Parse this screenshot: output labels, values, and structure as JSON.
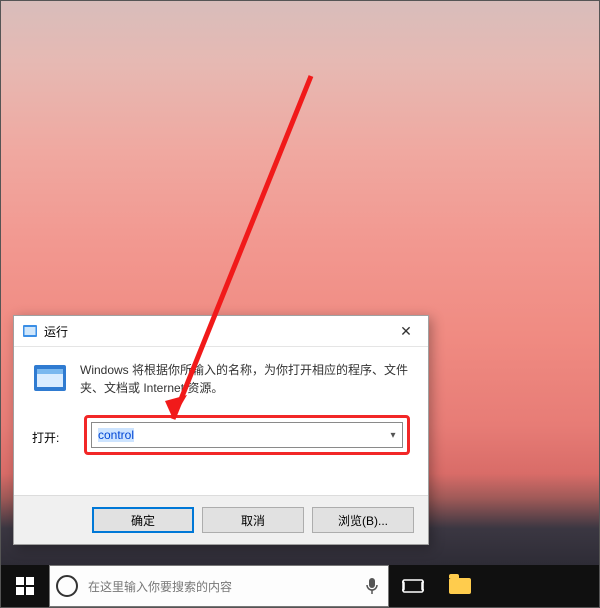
{
  "run_dialog": {
    "title": "运行",
    "description": "Windows 将根据你所输入的名称，为你打开相应的程序、文件夹、文档或 Internet 资源。",
    "open_label": "打开:",
    "input_value": "control",
    "buttons": {
      "ok": "确定",
      "cancel": "取消",
      "browse": "浏览(B)..."
    }
  },
  "taskbar": {
    "search_placeholder": "在这里输入你要搜索的内容"
  }
}
